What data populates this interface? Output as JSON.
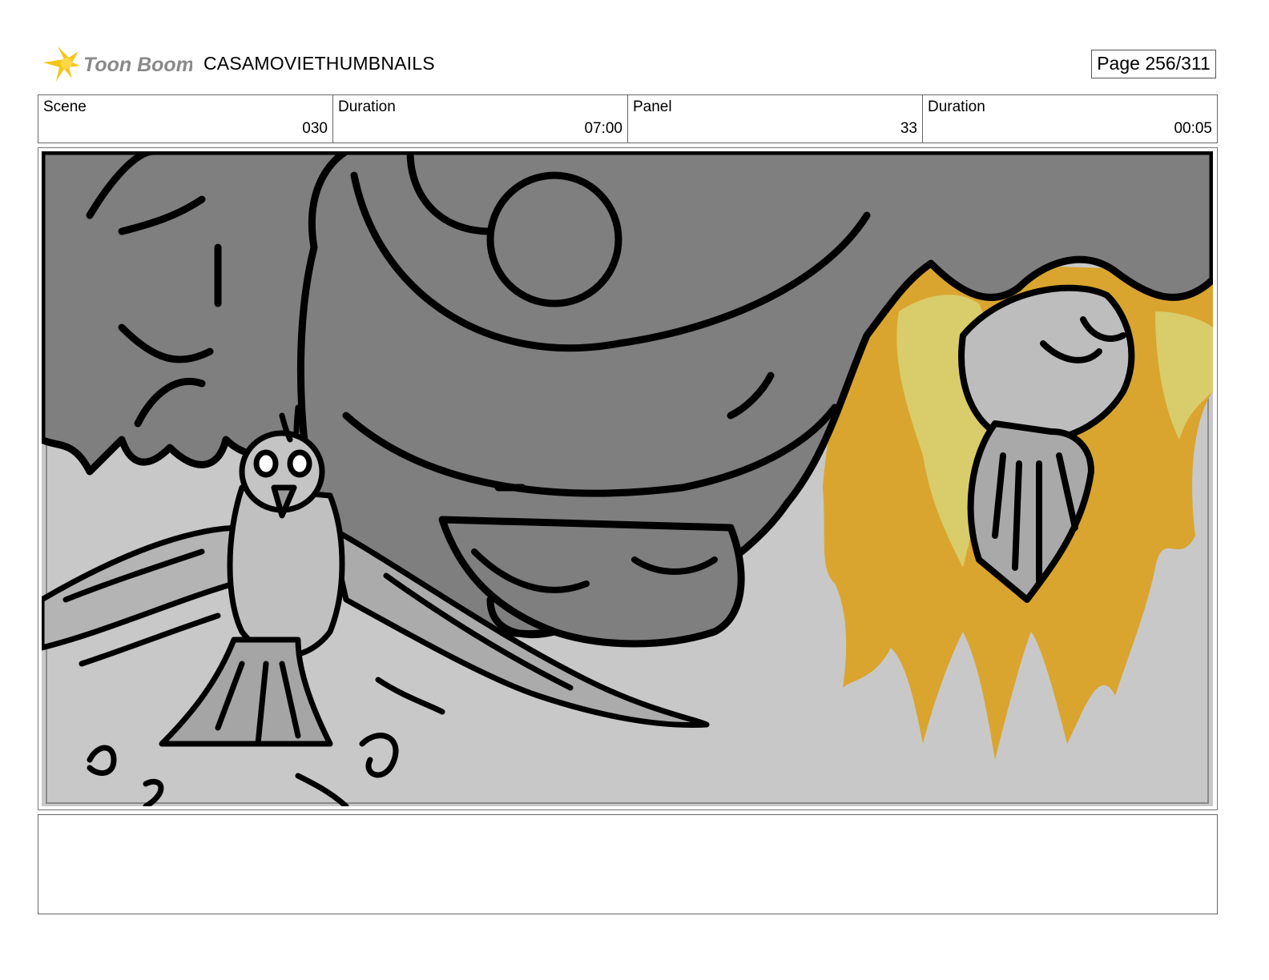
{
  "header": {
    "logo_text": "Toon Boom",
    "project_title": "CASAMOVIETHUMBNAILS",
    "page_label": "Page 256/311"
  },
  "info": {
    "scene_label": "Scene",
    "scene_value": "030",
    "scene_duration_label": "Duration",
    "scene_duration_value": "07:00",
    "panel_label": "Panel",
    "panel_value": "33",
    "panel_duration_label": "Duration",
    "panel_duration_value": "00:05"
  },
  "notes": {
    "text": ""
  },
  "colors": {
    "flame_orange": "#DAA52F",
    "flame_yellow": "#D9CC6A",
    "sketch_dark_gray": "#7F7F7F",
    "sketch_light_gray": "#C4C4C4",
    "logo_yellow": "#F5C518",
    "logo_gray": "#8A8A8A"
  }
}
